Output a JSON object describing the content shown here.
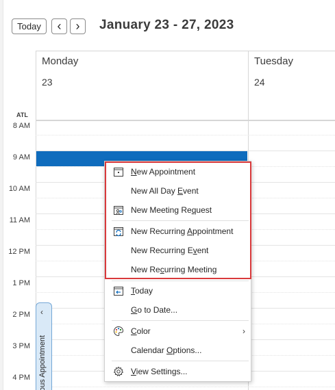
{
  "toolbar": {
    "today_label": "Today",
    "prev_glyph": "‹",
    "next_glyph": "›",
    "date_range": "January 23 - 27, 2023"
  },
  "calendar": {
    "timezone": "ATL",
    "days": [
      {
        "name": "Monday",
        "date": "23"
      },
      {
        "name": "Tuesday",
        "date": "24"
      }
    ],
    "times": [
      "8 AM",
      "9 AM",
      "10 AM",
      "11 AM",
      "12 PM",
      "1 PM",
      "2 PM",
      "3 PM",
      "4 PM"
    ],
    "appointment_color": "#0f6cbd",
    "previous_appointment_tab": {
      "chevron": "‹",
      "label": "Previous Appointment"
    }
  },
  "context_menu": {
    "highlight_color": "#d9393b",
    "items": [
      {
        "pre": "",
        "u": "N",
        "post": "ew Appointment",
        "icon": "new-appointment-icon"
      },
      {
        "pre": "New All Day ",
        "u": "E",
        "post": "vent",
        "icon": ""
      },
      {
        "pre": "New Meeting Re",
        "u": "q",
        "post": "uest",
        "icon": "meeting-request-icon"
      },
      {
        "pre": "New Recurring ",
        "u": "A",
        "post": "ppointment",
        "icon": "recurring-appointment-icon"
      },
      {
        "pre": "New Recurring E",
        "u": "v",
        "post": "ent",
        "icon": ""
      },
      {
        "pre": "New Re",
        "u": "c",
        "post": "urring Meeting",
        "icon": ""
      },
      {
        "pre": "",
        "u": "T",
        "post": "oday",
        "icon": "today-icon"
      },
      {
        "pre": "",
        "u": "G",
        "post": "o to Date...",
        "icon": ""
      },
      {
        "pre": "",
        "u": "C",
        "post": "olor",
        "icon": "color-palette-icon",
        "submenu": "›"
      },
      {
        "pre": "Calendar ",
        "u": "O",
        "post": "ptions...",
        "icon": ""
      },
      {
        "pre": "",
        "u": "V",
        "post": "iew Settings...",
        "icon": "settings-gear-icon"
      }
    ]
  }
}
